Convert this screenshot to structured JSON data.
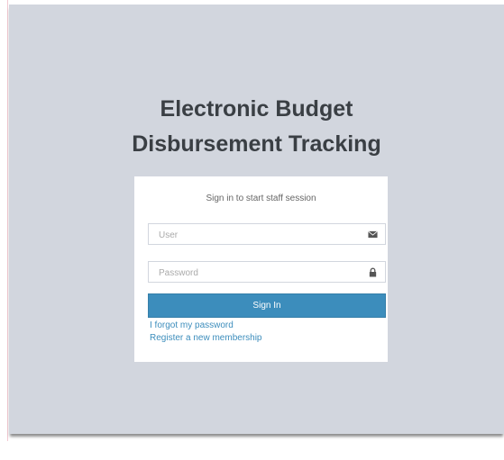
{
  "logo": {
    "line1": "Electronic Budget",
    "line2": "Disbursement Tracking"
  },
  "login_box": {
    "message": "Sign in to start staff session",
    "user_placeholder": "User",
    "password_placeholder": "Password",
    "signin_label": "Sign In",
    "forgot_label": "I forgot my password",
    "register_label": "Register a new membership"
  },
  "colors": {
    "background": "#d2d6de",
    "primary": "#3c8dbc",
    "title": "#3a3f44"
  },
  "icons": {
    "user_field": "envelope-icon",
    "password_field": "lock-icon"
  }
}
